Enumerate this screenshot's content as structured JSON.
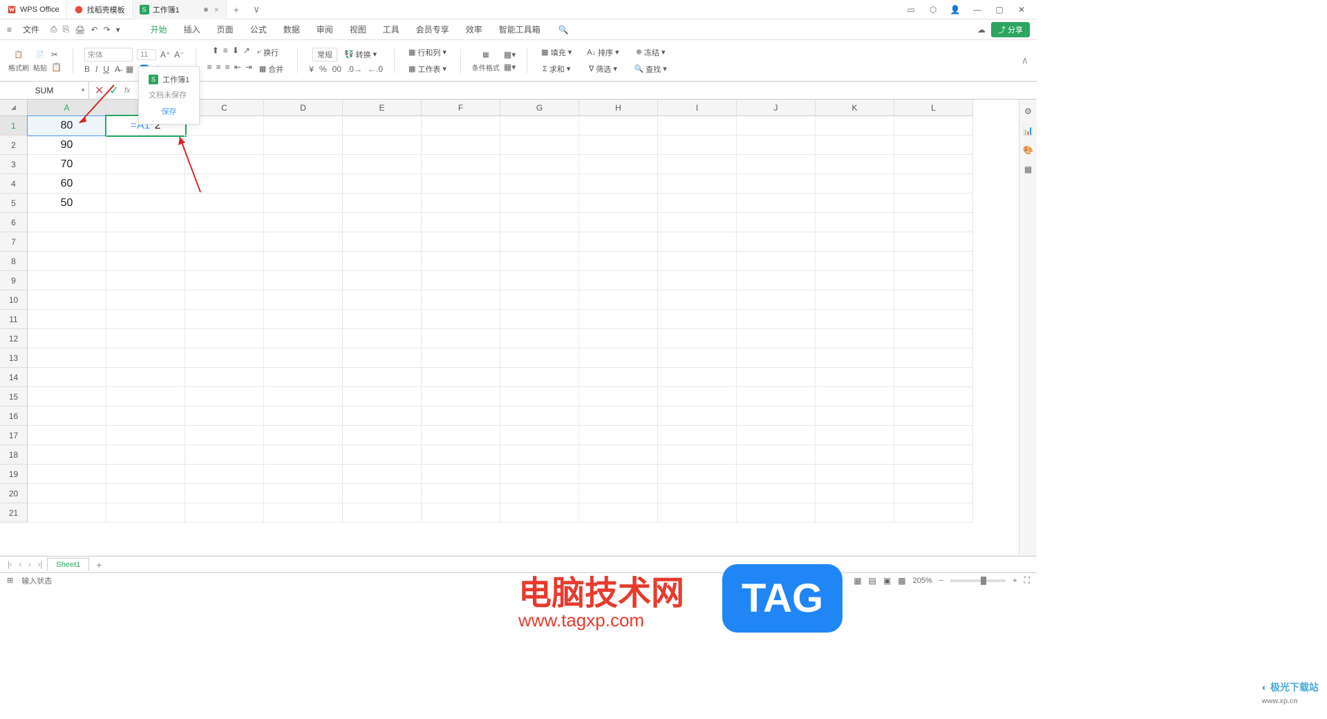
{
  "tabs": {
    "t1": "WPS Office",
    "t2": "找稻壳模板",
    "t3_icon": "S",
    "t3": "工作簿1"
  },
  "menu": {
    "file": "文件",
    "home": "开始",
    "insert": "插入",
    "page": "页面",
    "formula": "公式",
    "data": "数据",
    "review": "审阅",
    "view": "视图",
    "tools": "工具",
    "member": "会员专享",
    "efficiency": "效率",
    "smart": "智能工具箱",
    "share": "分享"
  },
  "ribbon": {
    "format_painter": "格式刷",
    "paste": "粘贴",
    "font_name": "宋体",
    "font_size": "11",
    "number_format": "常规",
    "convert": "转换",
    "row_col": "行和列",
    "worksheet": "工作表",
    "cond_format": "条件格式",
    "wrap": "换行",
    "merge": "合并",
    "fill": "填充",
    "sort": "排序",
    "freeze": "冻结",
    "sum": "求和",
    "filter": "筛选",
    "find": "查找"
  },
  "tooltip": {
    "title": "文档未保存",
    "save_btn": "保存"
  },
  "formula_bar": {
    "name_box": "SUM",
    "formula": "=A1*2"
  },
  "columns": [
    "A",
    "B",
    "C",
    "D",
    "E",
    "F",
    "G",
    "H",
    "I",
    "J",
    "K",
    "L"
  ],
  "rows": [
    1,
    2,
    3,
    4,
    5,
    6,
    7,
    8,
    9,
    10,
    11,
    12,
    13,
    14,
    15,
    16,
    17,
    18,
    19,
    20,
    21
  ],
  "cells": {
    "A1": "80",
    "A2": "90",
    "A3": "70",
    "A4": "60",
    "A5": "50",
    "B1_part1": "=A1",
    "B1_part2": "*2"
  },
  "watermark": {
    "text": "电脑技术网",
    "url": "www.tagxp.com",
    "tag": "TAG",
    "logo2": "极光下载站",
    "logo2_url": "www.xp.cn"
  },
  "sheet_tabs": {
    "sheet1": "Sheet1"
  },
  "status": {
    "mode": "输入状态",
    "zoom": "205%"
  }
}
